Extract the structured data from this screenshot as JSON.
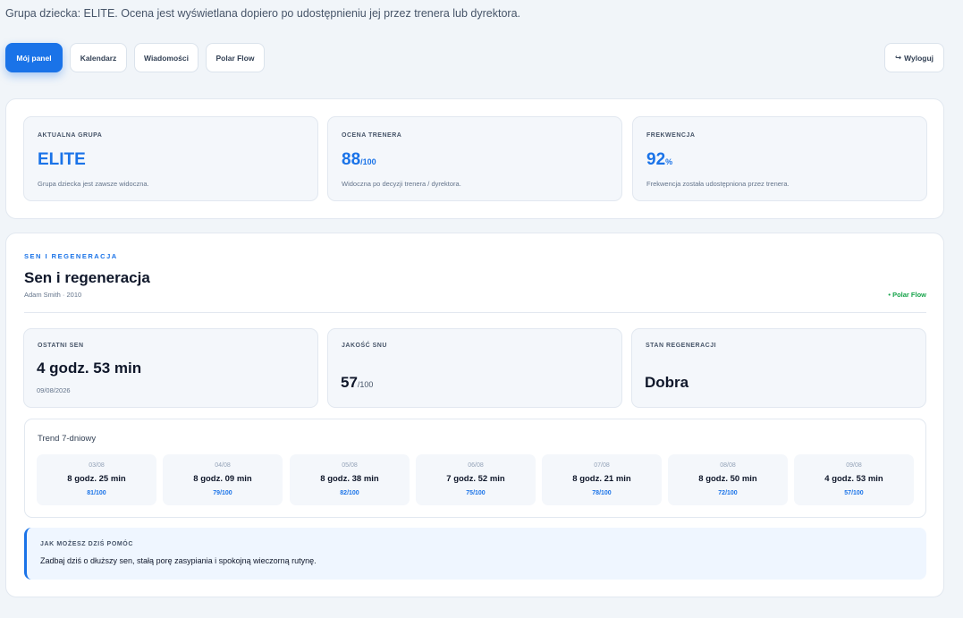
{
  "intro": "Grupa dziecka: ELITE. Ocena jest wyświetlana dopiero po udostępnieniu jej przez trenera lub dyrektora.",
  "nav": [
    {
      "label": "Mój panel"
    },
    {
      "label": "Kalendarz"
    },
    {
      "label": "Wiadomości"
    },
    {
      "label": "Polar Flow"
    }
  ],
  "logout": {
    "icon": "↪",
    "label": "Wyloguj"
  },
  "summary": {
    "group": {
      "label": "AKTUALNA GRUPA",
      "value": "ELITE",
      "note": "Grupa dziecka jest zawsze widoczna."
    },
    "rating": {
      "label": "OCENA TRENERA",
      "value": "88",
      "unit": "/100",
      "note": "Widoczna po decyzji trenera / dyrektora."
    },
    "attendance": {
      "label": "FREKWENCJA",
      "value": "92",
      "unit": "%",
      "note": "Frekwencja została udostępniona przez trenera."
    }
  },
  "sleep": {
    "eyebrow": "SEN I REGENERACJA",
    "title": "Sen i regeneracja",
    "subtitle": "Adam Smith · 2010",
    "source": "• Polar Flow",
    "last": {
      "label": "OSTATNI SEN",
      "value": "4 godz. 53 min",
      "date": "09/08/2026"
    },
    "quality": {
      "label": "JAKOŚĆ SNU",
      "value": "57",
      "unit": "/100"
    },
    "recovery": {
      "label": "STAN REGENERACJI",
      "value": "Dobra"
    },
    "trend": {
      "title": "Trend 7-dniowy",
      "days": [
        {
          "date": "03/08",
          "duration": "8 godz. 25 min",
          "score": "81/100"
        },
        {
          "date": "04/08",
          "duration": "8 godz. 09 min",
          "score": "79/100"
        },
        {
          "date": "05/08",
          "duration": "8 godz. 38 min",
          "score": "82/100"
        },
        {
          "date": "06/08",
          "duration": "7 godz. 52 min",
          "score": "75/100"
        },
        {
          "date": "07/08",
          "duration": "8 godz. 21 min",
          "score": "78/100"
        },
        {
          "date": "08/08",
          "duration": "8 godz. 50 min",
          "score": "72/100"
        },
        {
          "date": "09/08",
          "duration": "4 godz. 53 min",
          "score": "57/100"
        }
      ]
    },
    "tip": {
      "label": "JAK MOŻESZ DZIŚ POMÓC",
      "text": "Zadbaj dziś o dłuższy sen, stałą porę zasypiania i spokojną wieczorną rutynę."
    }
  }
}
